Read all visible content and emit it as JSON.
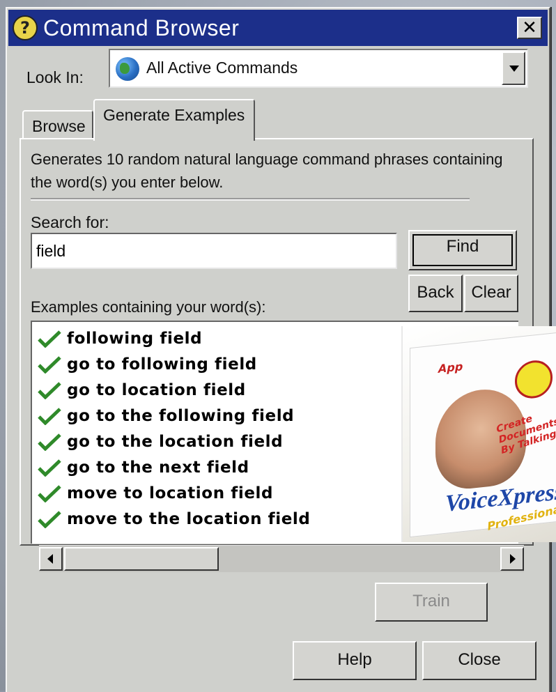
{
  "window": {
    "title": "Command Browser",
    "close_label": "✕"
  },
  "look_in": {
    "label": "Look In:",
    "value": "All Active Commands"
  },
  "tabs": [
    {
      "label": "Browse"
    },
    {
      "label": "Generate Examples"
    }
  ],
  "generate": {
    "description": "Generates 10 random natural language command phrases containing the word(s) you enter below.",
    "search_label": "Search for:",
    "search_value": "field",
    "find_label": "Find",
    "back_label": "Back",
    "clear_label": "Clear",
    "examples_label": "Examples containing your word(s):",
    "examples": [
      "following field",
      "go to following field",
      "go to location field",
      "go to the following field",
      "go to the location field",
      "go to the next field",
      "move to location field",
      "move to the location field"
    ]
  },
  "ad": {
    "logo": "App",
    "tagline": "Create Documents By Talking!",
    "brand": "VoiceXpress",
    "edition": "Professional"
  },
  "buttons": {
    "train_label": "Train",
    "help_label": "Help",
    "close_label": "Close"
  },
  "colors": {
    "titlebar": "#1c2f8a",
    "window_face": "#cfd0cc",
    "check_green": "#2f8a2a"
  }
}
